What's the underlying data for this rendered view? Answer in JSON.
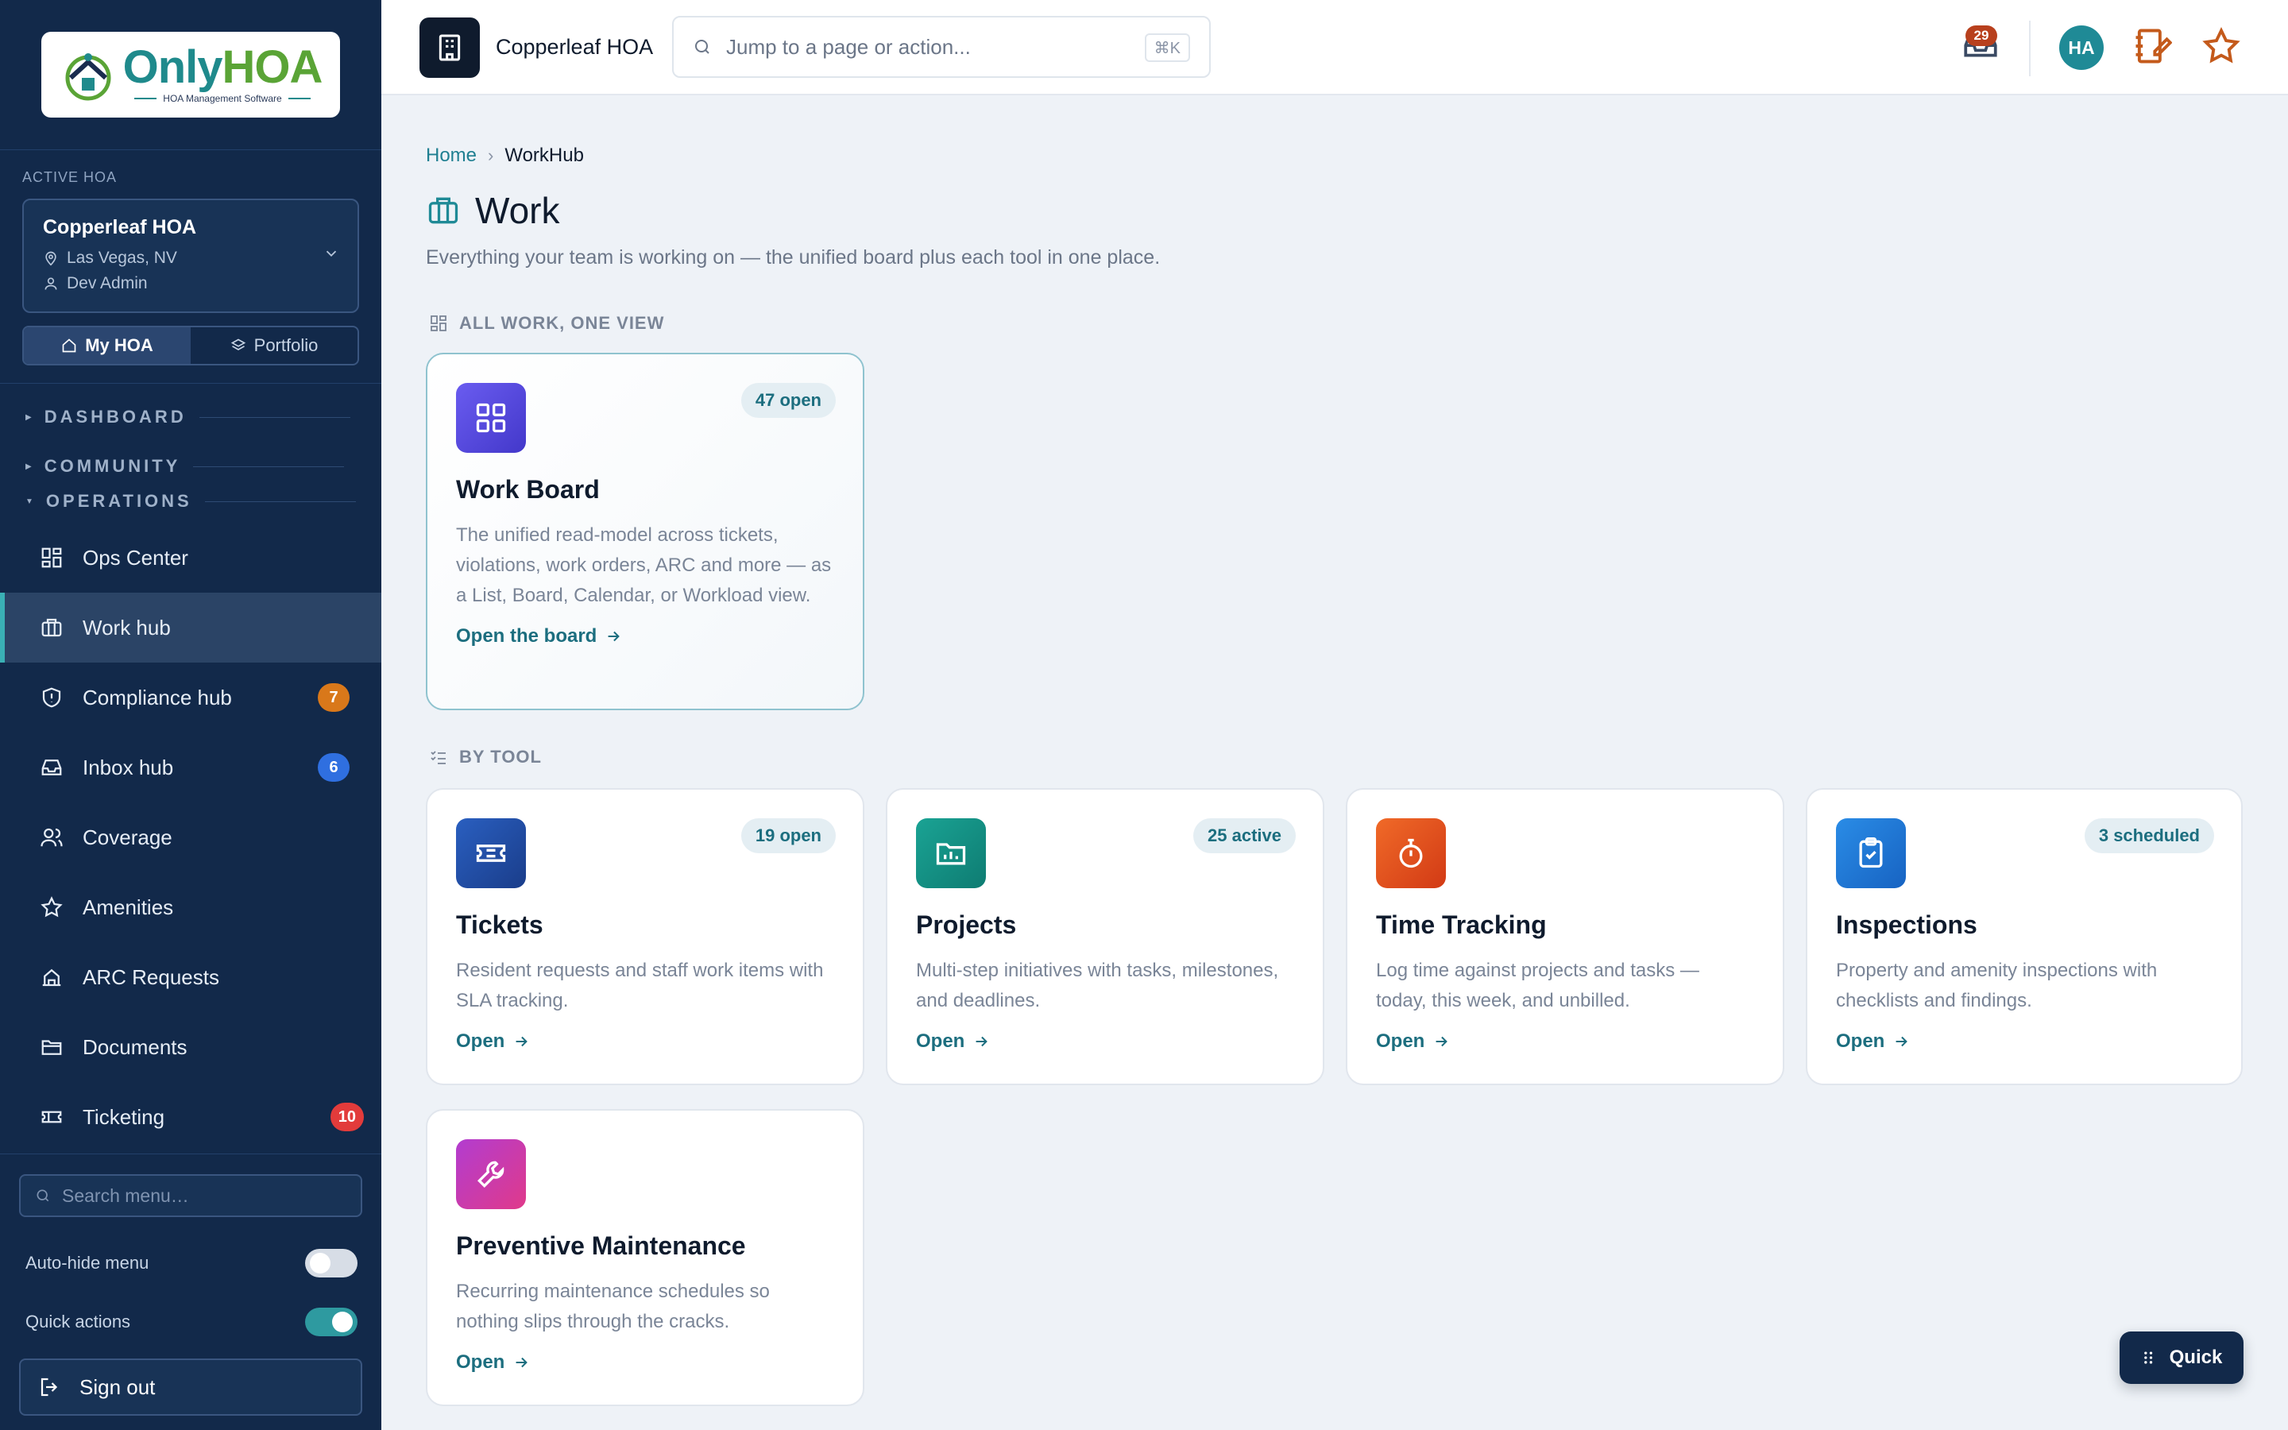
{
  "brand": {
    "logo_main_1": "Only",
    "logo_main_2": "HOA",
    "logo_sub": "HOA Management Software"
  },
  "sidebar": {
    "active_hoa_label": "ACTIVE HOA",
    "hoa_name": "Copperleaf HOA",
    "hoa_location": "Las Vegas, NV",
    "hoa_user": "Dev Admin",
    "segment": {
      "my_hoa": "My HOA",
      "portfolio": "Portfolio"
    },
    "sections": {
      "dashboard": "DASHBOARD",
      "community": "COMMUNITY",
      "operations": "OPERATIONS"
    },
    "items": [
      {
        "label": "Ops Center",
        "icon": "grid-icon"
      },
      {
        "label": "Work hub",
        "icon": "briefcase-icon",
        "active": true
      },
      {
        "label": "Compliance hub",
        "icon": "shield-icon",
        "badge": "7",
        "badge_color": "#d9781a"
      },
      {
        "label": "Inbox hub",
        "icon": "inbox-icon",
        "badge": "6",
        "badge_color": "#2f6fe0"
      },
      {
        "label": "Coverage",
        "icon": "users-icon"
      },
      {
        "label": "Amenities",
        "icon": "star-icon"
      },
      {
        "label": "ARC Requests",
        "icon": "home-icon"
      },
      {
        "label": "Documents",
        "icon": "folder-icon"
      },
      {
        "label": "Ticketing",
        "icon": "ticket-icon",
        "badge": "10",
        "badge_color": "#e23b3b"
      }
    ],
    "search_placeholder": "Search menu…",
    "auto_hide_label": "Auto-hide menu",
    "auto_hide_on": false,
    "quick_actions_label": "Quick actions",
    "quick_actions_on": true,
    "sign_out": "Sign out"
  },
  "topbar": {
    "org_name": "Copperleaf HOA",
    "search_placeholder": "Jump to a page or action...",
    "search_shortcut": "⌘K",
    "notification_count": "29",
    "avatar_initials": "HA"
  },
  "main": {
    "breadcrumb": {
      "home": "Home",
      "current": "WorkHub"
    },
    "title": "Work",
    "subtitle": "Everything your team is working on — the unified board plus each tool in one place.",
    "group_all": "ALL WORK, ONE VIEW",
    "group_tools": "BY TOOL",
    "featured": {
      "badge": "47 open",
      "title": "Work Board",
      "desc": "The unified read-model across tickets, violations, work orders, ARC and more — as a List, Board, Calendar, or Workload view.",
      "link": "Open the board"
    },
    "tools": [
      {
        "badge": "19 open",
        "title": "Tickets",
        "desc": "Resident requests and staff work items with SLA tracking.",
        "link": "Open",
        "icon": "ticket-icon"
      },
      {
        "badge": "25 active",
        "title": "Projects",
        "desc": "Multi-step initiatives with tasks, milestones, and deadlines.",
        "link": "Open",
        "icon": "project-icon"
      },
      {
        "badge": "",
        "title": "Time Tracking",
        "desc": "Log time against projects and tasks — today, this week, and unbilled.",
        "link": "Open",
        "icon": "stopwatch-icon"
      },
      {
        "badge": "3 scheduled",
        "title": "Inspections",
        "desc": "Property and amenity inspections with checklists and findings.",
        "link": "Open",
        "icon": "clipboard-icon"
      },
      {
        "badge": "",
        "title": "Preventive Maintenance",
        "desc": "Recurring maintenance schedules so nothing slips through the cracks.",
        "link": "Open",
        "icon": "wrench-icon"
      }
    ]
  },
  "quick_button": "Quick",
  "colors": {
    "sidebar_bg": "#12294a",
    "accent_teal": "#1c6e7f",
    "work_board_icon": "#5b4fe6",
    "tickets_icon": "#1f4fa8",
    "projects_icon": "#13948a",
    "time_icon": "#e2521c",
    "inspections_icon": "#1f7fd8",
    "pm_icon": "#c534a8"
  }
}
